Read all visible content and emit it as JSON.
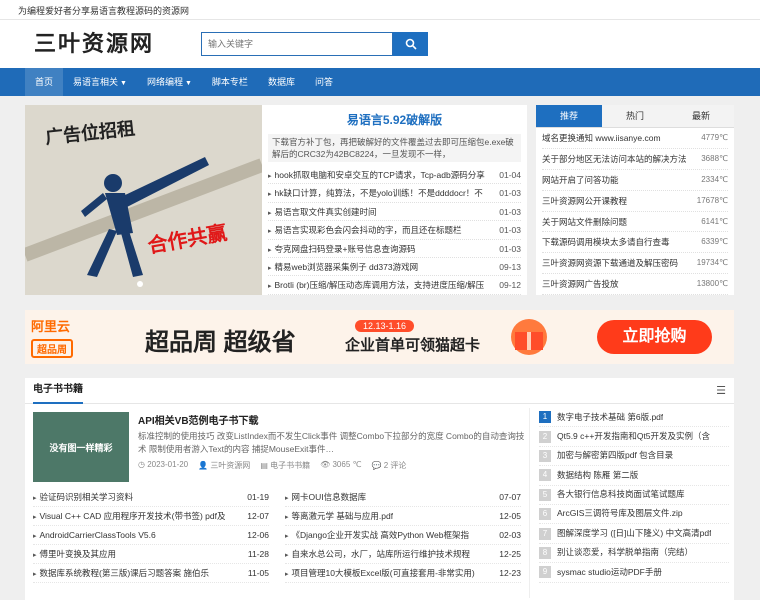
{
  "topbar": {
    "text": "为编程爱好者分享易语言教程源码的资源网"
  },
  "header": {
    "logo_text": "三叶资源网",
    "search_placeholder": "输入关键字"
  },
  "nav": {
    "items": [
      {
        "label": "首页",
        "dropdown": false
      },
      {
        "label": "易语言相关",
        "dropdown": true
      },
      {
        "label": "网络编程",
        "dropdown": true
      },
      {
        "label": "脚本专栏",
        "dropdown": false
      },
      {
        "label": "数据库",
        "dropdown": false
      },
      {
        "label": "问答",
        "dropdown": false
      }
    ]
  },
  "banner": {
    "line1": "广告位招租",
    "line2": "合作共赢"
  },
  "headline": {
    "title": "易语言5.92破解版",
    "desc": "下载官方补丁包，再把破解好的文件覆盖过去即可压缩包e.exe破解后的CRC32为42BC8224，一旦发现不一样，",
    "items": [
      {
        "title": "hook抓取电脑和安卓交互的TCP请求，Tcp-adb源码分享",
        "date": "01-04"
      },
      {
        "title": "hk缺口计算，纯算法，不是yolo训练！不是ddddocr！不",
        "date": "01-03"
      },
      {
        "title": "易语言取文件真实创建时间",
        "date": "01-03"
      },
      {
        "title": "易语言实现彩色会闪会抖动的字，而且还在标题栏",
        "date": "01-03"
      },
      {
        "title": "夸克网盘扫码登录+账号信息查询源码",
        "date": "01-03"
      },
      {
        "title": "精易web浏览器采集例子 dd373游戏网",
        "date": "09-13"
      },
      {
        "title": "Brotli (br)压缩/解压动态库调用方法，支持进度压缩/解压",
        "date": "09-12"
      }
    ]
  },
  "tabs": {
    "labels": [
      "推荐",
      "热门",
      "最新"
    ],
    "items": [
      {
        "title": "域名更换通知 www.iisanye.com",
        "value": "4779℃"
      },
      {
        "title": "关于部分地区无法访问本站的解决方法",
        "value": "3688℃"
      },
      {
        "title": "网站开启了问答功能",
        "value": "2334℃"
      },
      {
        "title": "三叶资源网公开课教程",
        "value": "17678℃"
      },
      {
        "title": "关于网站文件删除问题",
        "value": "6141℃"
      },
      {
        "title": "下载源码调用模块太多请自行查毒",
        "value": "6339℃"
      },
      {
        "title": "三叶资源网资源下载通道及解压密码",
        "value": "19734℃"
      },
      {
        "title": "三叶资源网广告投放",
        "value": "13800℃"
      }
    ]
  },
  "ad": {
    "brand": "阿里云",
    "brand_sub": "超品周",
    "slogan": "超品周 超级省",
    "date": "12.13-1.16",
    "sub": "企业首单可领猫超卡",
    "cta": "立即抢购"
  },
  "books": {
    "section_title": "电子书书籍",
    "feature": {
      "image_text": "没有图一样精彩",
      "title": "API相关VB范例电子书下载",
      "desc": "标准控制的使用技巧 改变ListIndex而不发生Click事件 调整Combo下拉部分的宽度 Combo的自动查询技术 限制使用者游入Text的内容 捕捉MouseExit事件…",
      "date": "2023-01-20",
      "author": "三叶资源网",
      "category": "电子书书籍",
      "views": "3065 ℃",
      "comments": "2 评论"
    },
    "left_list": [
      {
        "title": "验证码识别相关学习资料",
        "date": "01-19"
      },
      {
        "title": "Visual C++ CAD 应用程序开发技术(带书签) pdf及",
        "date": "12-07"
      },
      {
        "title": "AndroidCarrierClassTools V5.6",
        "date": "12-06"
      },
      {
        "title": "傅里叶变换及其应用",
        "date": "11-28"
      },
      {
        "title": "数据库系统教程(第三版)课后习题答案 施伯乐",
        "date": "11-05"
      }
    ],
    "mid_list": [
      {
        "title": "网卡OUI信息数据库",
        "date": "07-07"
      },
      {
        "title": "等离激元学 基础与应用.pdf",
        "date": "12-05"
      },
      {
        "title": "《Django企业开发实战 高效Python Web框架指",
        "date": "02-03"
      },
      {
        "title": "自来水总公司，水厂，站库所运行维护技术规程",
        "date": "12-25"
      },
      {
        "title": "项目管理10大模板Excel版(可直接套用-非常实用)",
        "date": "12-23"
      }
    ],
    "ranked": [
      {
        "n": "1",
        "title": "数字电子技术基础 第6版.pdf"
      },
      {
        "n": "2",
        "title": "Qt5.9 c++开发指南和Qt5开发及实例（含"
      },
      {
        "n": "3",
        "title": "加密与解密第四版pdf 包含目录"
      },
      {
        "n": "4",
        "title": "数据结构 陈雁 第二版"
      },
      {
        "n": "5",
        "title": "各大银行信息科技岗面试笔试题库"
      },
      {
        "n": "6",
        "title": "ArcGIS三调符号库及图层文件.zip"
      },
      {
        "n": "7",
        "title": "图解深度学习 ([日]山下隆义) 中文高清pdf"
      },
      {
        "n": "8",
        "title": "别让谈恋爱，科学脱单指南（完结）"
      },
      {
        "n": "9",
        "title": "sysmac studio运动PDF手册"
      }
    ]
  }
}
